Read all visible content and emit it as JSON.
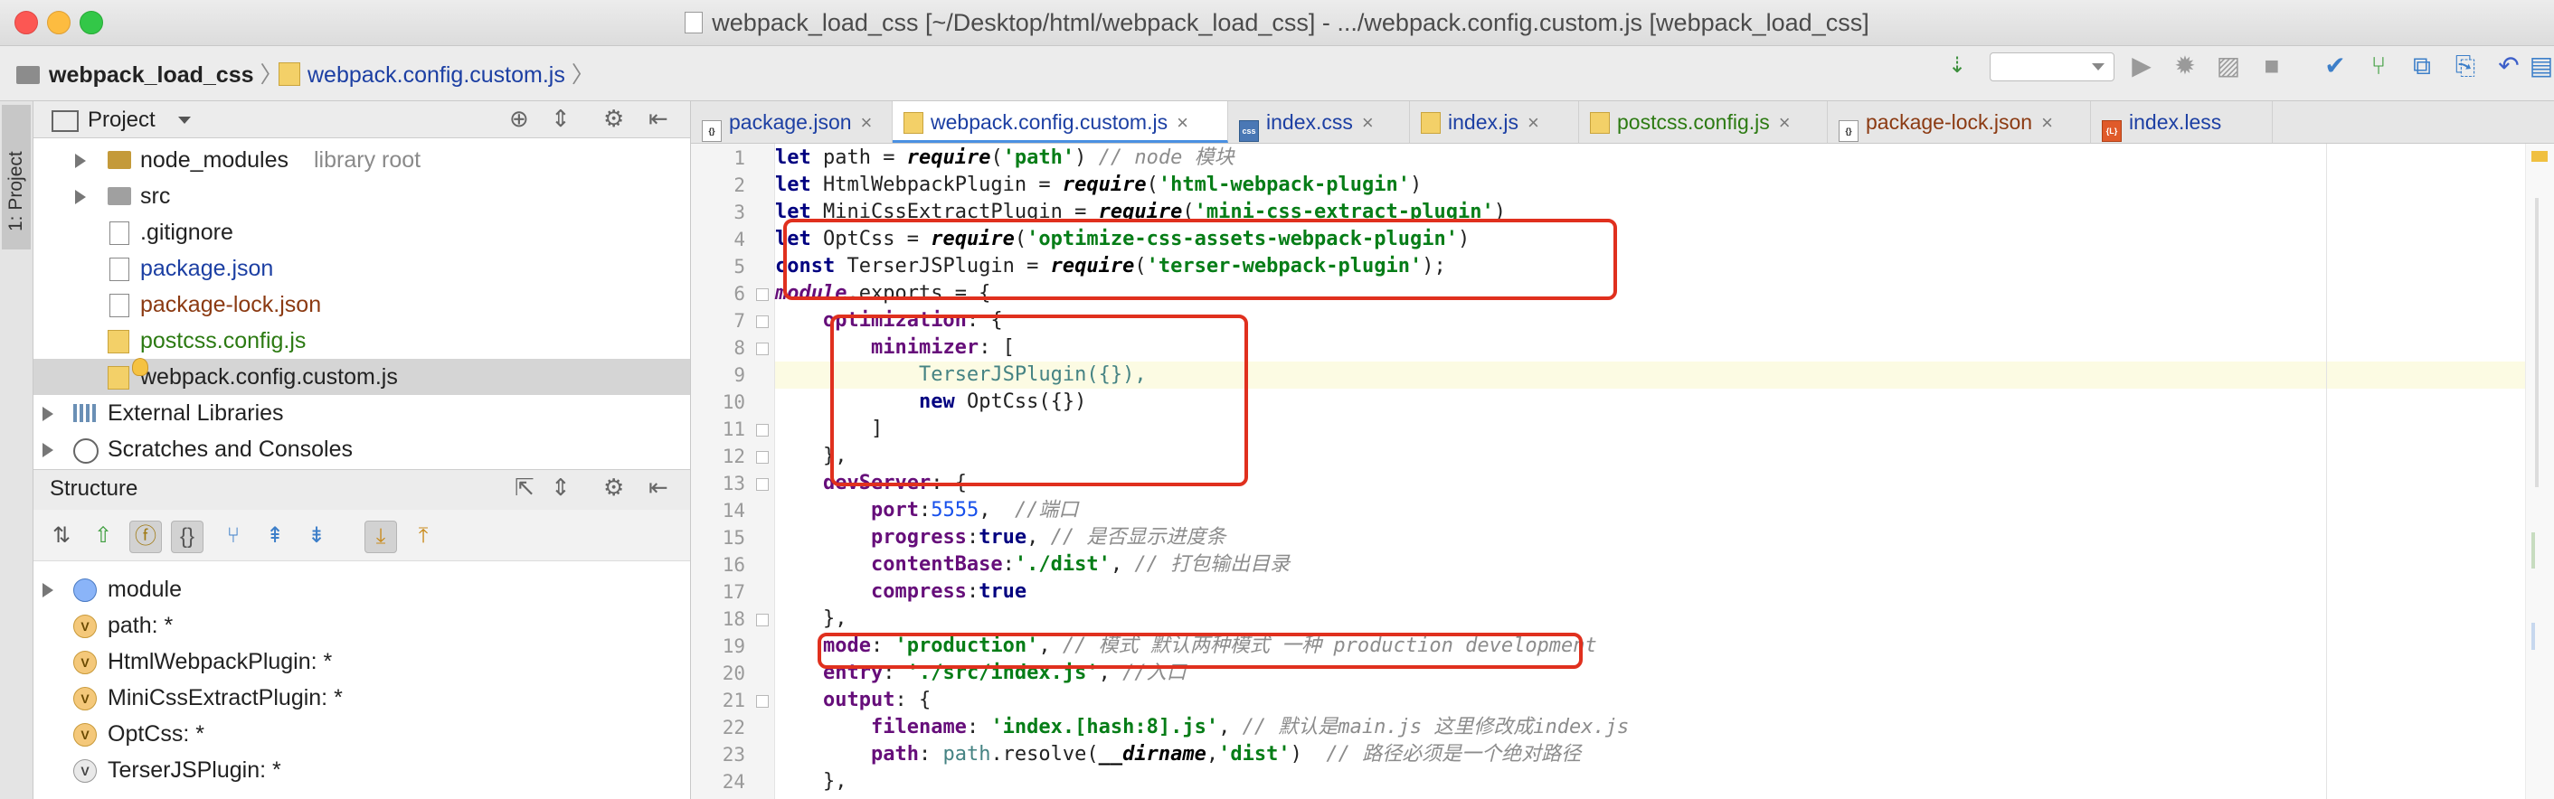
{
  "window": {
    "title": "webpack_load_css [~/Desktop/html/webpack_load_css] - .../webpack.config.custom.js [webpack_load_css]"
  },
  "navbar": {
    "project_name": "webpack_load_css",
    "file_name": "webpack.config.custom.js"
  },
  "left_stripe": {
    "project_tab": "1: Project"
  },
  "project_panel": {
    "title": "Project",
    "items": [
      {
        "label": "node_modules",
        "suffix": "library root"
      },
      {
        "label": "src"
      },
      {
        "label": ".gitignore"
      },
      {
        "label": "package.json"
      },
      {
        "label": "package-lock.json"
      },
      {
        "label": "postcss.config.js"
      },
      {
        "label": "webpack.config.custom.js"
      },
      {
        "label": "External Libraries"
      },
      {
        "label": "Scratches and Consoles"
      }
    ]
  },
  "structure_panel": {
    "title": "Structure",
    "items": [
      {
        "label": "module"
      },
      {
        "label": "path: *"
      },
      {
        "label": "HtmlWebpackPlugin: *"
      },
      {
        "label": "MiniCssExtractPlugin: *"
      },
      {
        "label": "OptCss: *"
      },
      {
        "label": "TerserJSPlugin: *"
      }
    ]
  },
  "tabs": [
    {
      "label": "package.json"
    },
    {
      "label": "webpack.config.custom.js"
    },
    {
      "label": "index.css"
    },
    {
      "label": "index.js"
    },
    {
      "label": "postcss.config.js"
    },
    {
      "label": "package-lock.json"
    },
    {
      "label": "index.less"
    }
  ],
  "editor": {
    "line_numbers": [
      "1",
      "2",
      "3",
      "4",
      "5",
      "6",
      "7",
      "8",
      "9",
      "10",
      "11",
      "12",
      "13",
      "14",
      "15",
      "16",
      "17",
      "18",
      "19",
      "20",
      "21",
      "22",
      "23",
      "24"
    ],
    "code": {
      "l1_kw": "let",
      "l1_a": " path = ",
      "l1_fn": "require",
      "l1_b": "(",
      "l1_str": "'path'",
      "l1_c": ") ",
      "l1_cm": "// node 模块",
      "l2_kw": "let",
      "l2_a": " HtmlWebpackPlugin = ",
      "l2_fn": "require",
      "l2_b": "(",
      "l2_str": "'html-webpack-plugin'",
      "l2_c": ")",
      "l3_kw": "let",
      "l3_a": " MiniCssExtractPlugin = ",
      "l3_fn": "require",
      "l3_b": "(",
      "l3_str": "'mini-css-extract-plugin'",
      "l3_c": ")",
      "l4_kw": "let",
      "l4_a": " OptCss = ",
      "l4_fn": "require",
      "l4_b": "(",
      "l4_str": "'optimize-css-assets-webpack-plugin'",
      "l4_c": ")",
      "l5_kw": "const",
      "l5_a": " TerserJSPlugin = ",
      "l5_fn": "require",
      "l5_b": "(",
      "l5_str": "'terser-webpack-plugin'",
      "l5_c": ");",
      "l6_a": "module",
      "l6_b": ".exports = {",
      "l7_ind": "    ",
      "l7_prop": "optimization",
      "l7_a": ": {",
      "l8_ind": "        ",
      "l8_prop": "minimizer",
      "l8_a": ": [",
      "l9_ind": "            ",
      "l9_a": "TerserJSPlugin({}),",
      "l10_ind": "            ",
      "l10_kw": "new",
      "l10_a": " OptCss({})",
      "l11_ind": "        ",
      "l11_a": "]",
      "l12_ind": "    ",
      "l12_a": "},",
      "l13_ind": "    ",
      "l13_prop": "devServer",
      "l13_a": ": {",
      "l14_ind": "        ",
      "l14_prop": "port",
      "l14_a": ":",
      "l14_num": "5555",
      "l14_b": ",  ",
      "l14_cm": "//端口",
      "l15_ind": "        ",
      "l15_prop": "progress",
      "l15_a": ":",
      "l15_kw": "true",
      "l15_b": ", ",
      "l15_cm": "// 是否显示进度条",
      "l16_ind": "        ",
      "l16_prop": "contentBase",
      "l16_a": ":",
      "l16_str": "'./dist'",
      "l16_b": ", ",
      "l16_cm": "// 打包输出目录",
      "l17_ind": "        ",
      "l17_prop": "compress",
      "l17_a": ":",
      "l17_kw": "true",
      "l18_ind": "    ",
      "l18_a": "},",
      "l19_ind": "    ",
      "l19_prop": "mode",
      "l19_a": ": ",
      "l19_str": "'production'",
      "l19_b": ", ",
      "l19_cm": "// 模式 默认两种模式 一种 production development",
      "l20_ind": "    ",
      "l20_prop": "entry",
      "l20_a": ": ",
      "l20_str": "'./src/index.js'",
      "l20_b": ", ",
      "l20_cm": "//入口",
      "l21_ind": "    ",
      "l21_prop": "output",
      "l21_a": ": {",
      "l22_ind": "        ",
      "l22_prop": "filename",
      "l22_a": ": ",
      "l22_str": "'index.[hash:8].js'",
      "l22_b": ", ",
      "l22_cm": "// 默认是main.js 这里修改成index.js",
      "l23_ind": "        ",
      "l23_prop": "path",
      "l23_a": ": ",
      "l23_var": "path",
      "l23_b": ".resolve(",
      "l23_dn": "__dirname",
      "l23_c": ",",
      "l23_str": "'dist'",
      "l23_d": ")  ",
      "l23_cm": "// 路径必须是一个绝对路径",
      "l24_ind": "    ",
      "l24_a": "},"
    }
  },
  "colors": {
    "annotation": "#e0301e",
    "keyword": "#000080",
    "string": "#067d17",
    "comment": "#8c8c8c",
    "property": "#660e7a"
  }
}
